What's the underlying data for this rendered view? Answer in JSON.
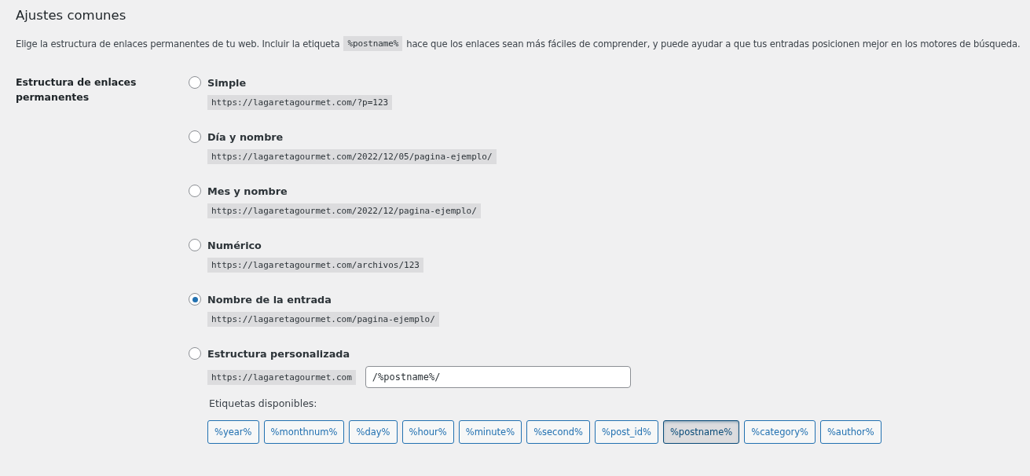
{
  "heading": "Ajustes comunes",
  "intro": {
    "before": "Elige la estructura de enlaces permanentes de tu web. Incluir la etiqueta",
    "code": "%postname%",
    "after": "hace que los enlaces sean más fáciles de comprender, y puede ayudar a que tus entradas posicionen mejor en los motores de búsqueda."
  },
  "field_label": "Estructura de enlaces permanentes",
  "options": [
    {
      "kind": "preset",
      "label": "Simple",
      "example": "https://lagaretagourmet.com/?p=123",
      "selected": false
    },
    {
      "kind": "preset",
      "label": "Día y nombre",
      "example": "https://lagaretagourmet.com/2022/12/05/pagina-ejemplo/",
      "selected": false
    },
    {
      "kind": "preset",
      "label": "Mes y nombre",
      "example": "https://lagaretagourmet.com/2022/12/pagina-ejemplo/",
      "selected": false
    },
    {
      "kind": "preset",
      "label": "Numérico",
      "example": "https://lagaretagourmet.com/archivos/123",
      "selected": false
    },
    {
      "kind": "preset",
      "label": "Nombre de la entrada",
      "example": "https://lagaretagourmet.com/pagina-ejemplo/",
      "selected": true
    },
    {
      "kind": "custom",
      "label": "Estructura personalizada",
      "example": "https://lagaretagourmet.com",
      "value": "/%postname%/",
      "selected": false
    }
  ],
  "tags_label": "Etiquetas disponibles:",
  "tags": [
    {
      "label": "%year%",
      "selected": false
    },
    {
      "label": "%monthnum%",
      "selected": false
    },
    {
      "label": "%day%",
      "selected": false
    },
    {
      "label": "%hour%",
      "selected": false
    },
    {
      "label": "%minute%",
      "selected": false
    },
    {
      "label": "%second%",
      "selected": false
    },
    {
      "label": "%post_id%",
      "selected": false
    },
    {
      "label": "%postname%",
      "selected": true
    },
    {
      "label": "%category%",
      "selected": false
    },
    {
      "label": "%author%",
      "selected": false
    }
  ]
}
